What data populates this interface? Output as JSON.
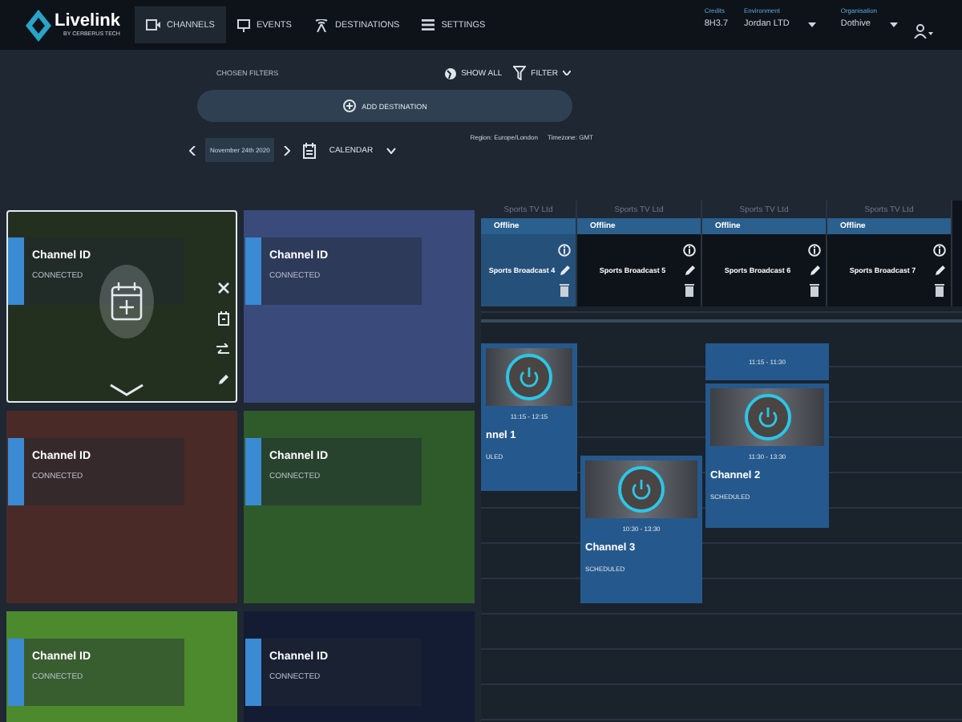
{
  "logo": {
    "name": "Livelink",
    "tagline": "BY CERBERUS TECH"
  },
  "nav": [
    {
      "label": "CHANNELS",
      "selected": true
    },
    {
      "label": "EVENTS",
      "selected": false
    },
    {
      "label": "DESTINATIONS",
      "selected": false
    },
    {
      "label": "SETTINGS",
      "selected": false
    }
  ],
  "account": [
    {
      "label": "Credits",
      "value": "8H3.7",
      "dropdown": false
    },
    {
      "label": "Environment",
      "value": "Jordan LTD",
      "dropdown": true
    },
    {
      "label": "Organisation",
      "value": "Dothive",
      "dropdown": true
    }
  ],
  "filters": {
    "label": "CHOSEN FILTERS",
    "show_all": "SHOW ALL",
    "filter": "FILTER"
  },
  "add_destination": "ADD DESTINATION",
  "date": {
    "value": "November 24th 2020",
    "calendar": "CALENDAR"
  },
  "region": "Region: Europe/London",
  "timezone": "Timezone: GMT",
  "channels": [
    {
      "name": "Channel ID",
      "status": "CONNECTED",
      "selected": true
    },
    {
      "name": "Channel ID",
      "status": "CONNECTED",
      "selected": false
    },
    {
      "name": "Channel ID",
      "status": "CONNECTED",
      "selected": false
    },
    {
      "name": "Channel ID",
      "status": "CONNECTED",
      "selected": false
    },
    {
      "name": "Channel ID",
      "status": "CONNECTED",
      "selected": false
    },
    {
      "name": "Channel ID",
      "status": "CONNECTED",
      "selected": false
    }
  ],
  "destinations": [
    {
      "owner": "Sports TV Ltd",
      "status": "Offline",
      "name": "Sports Broadcast 4"
    },
    {
      "owner": "Sports TV Ltd",
      "status": "Offline",
      "name": "Sports Broadcast 5"
    },
    {
      "owner": "Sports TV Ltd",
      "status": "Offline",
      "name": "Sports Broadcast 6"
    },
    {
      "owner": "Sports TV Ltd",
      "status": "Offline",
      "name": "Sports Broadcast 7"
    }
  ],
  "events": [
    {
      "kind": "card",
      "time": "11:15 - 12:15",
      "title": "nnel 1",
      "status": "ULED"
    },
    {
      "kind": "slot",
      "time": "11:15 - 11:30"
    },
    {
      "kind": "card",
      "time": "11:30 - 13:30",
      "title": "Channel 2",
      "status": "SCHEDULED"
    },
    {
      "kind": "card",
      "time": "10:30 - 13:30",
      "title": "Channel 3",
      "status": "SCHEDULED"
    }
  ]
}
